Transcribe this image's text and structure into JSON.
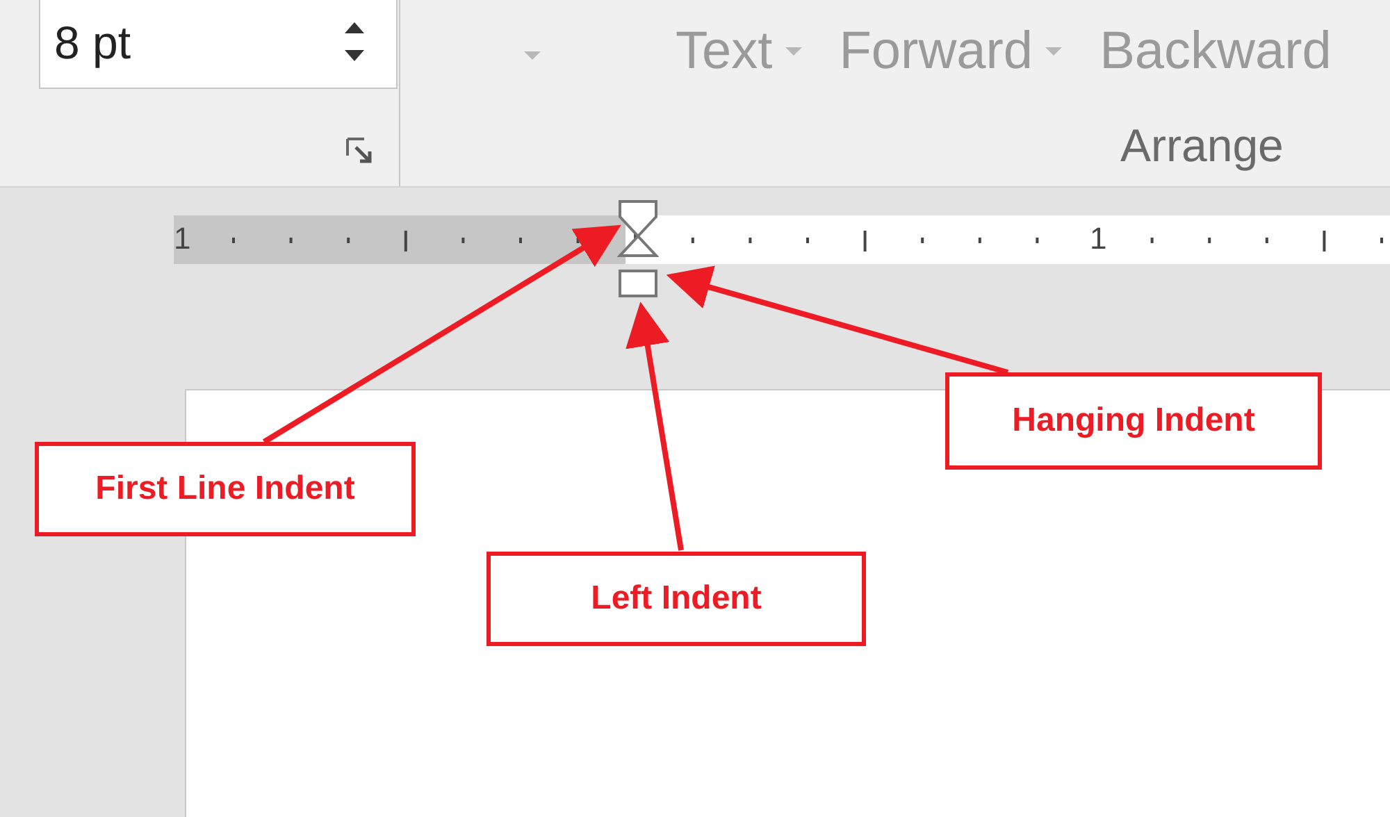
{
  "size_field": {
    "value": "8 pt"
  },
  "arrange_group": {
    "buttons": [
      "Text",
      "Forward",
      "Backward"
    ],
    "label": "Arrange"
  },
  "ruler": {
    "numbers": [
      "1",
      "1"
    ]
  },
  "callouts": [
    {
      "text": "First Line Indent"
    },
    {
      "text": "Left Indent"
    },
    {
      "text": "Hanging Indent"
    }
  ]
}
